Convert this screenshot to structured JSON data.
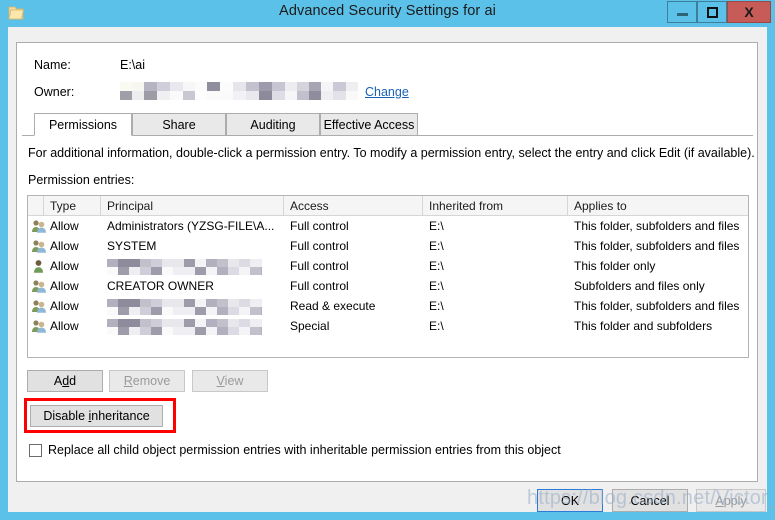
{
  "window": {
    "title": "Advanced Security Settings for ai",
    "icon": "folder-icon",
    "accent_color": "#5CC1E8",
    "close_color": "#C75B58",
    "controls": {
      "minimize": "–",
      "maximize": "□",
      "close": "X"
    }
  },
  "fields": {
    "name_label": "Name:",
    "name_value": "E:\\ai",
    "owner_label": "Owner:",
    "owner_value": "",
    "change_link": "Change"
  },
  "tabs": [
    {
      "label": "Permissions",
      "active": true
    },
    {
      "label": "Share",
      "active": false
    },
    {
      "label": "Auditing",
      "active": false
    },
    {
      "label": "Effective Access",
      "active": false
    }
  ],
  "info_text": "For additional information, double-click a permission entry. To modify a permission entry, select the entry and click Edit (if available).",
  "entries_label": "Permission entries:",
  "table": {
    "columns": [
      "",
      "Type",
      "Principal",
      "Access",
      "Inherited from",
      "Applies to"
    ],
    "rows": [
      {
        "icon": "group-icon",
        "type": "Allow",
        "principal": "Administrators (YZSG-FILE\\A...",
        "redacted": false,
        "access": "Full control",
        "inherited_from": "E:\\",
        "applies_to": "This folder, subfolders and files"
      },
      {
        "icon": "group-icon",
        "type": "Allow",
        "principal": "SYSTEM",
        "redacted": false,
        "access": "Full control",
        "inherited_from": "E:\\",
        "applies_to": "This folder, subfolders and files"
      },
      {
        "icon": "user-icon",
        "type": "Allow",
        "principal": "",
        "redacted": true,
        "access": "Full control",
        "inherited_from": "E:\\",
        "applies_to": "This folder only"
      },
      {
        "icon": "group-icon",
        "type": "Allow",
        "principal": "CREATOR OWNER",
        "redacted": false,
        "access": "Full control",
        "inherited_from": "E:\\",
        "applies_to": "Subfolders and files only"
      },
      {
        "icon": "group-icon",
        "type": "Allow",
        "principal": "",
        "redacted": true,
        "access": "Read & execute",
        "inherited_from": "E:\\",
        "applies_to": "This folder, subfolders and files"
      },
      {
        "icon": "group-icon",
        "type": "Allow",
        "principal": "",
        "redacted": true,
        "access": "Special",
        "inherited_from": "E:\\",
        "applies_to": "This folder and subfolders"
      }
    ]
  },
  "buttons": {
    "add": "Add",
    "remove": "Remove",
    "view": "View",
    "disable_inheritance": "Disable inheritance",
    "ok": "OK",
    "cancel": "Cancel",
    "apply": "Apply"
  },
  "highlight": {
    "color": "#FF0000",
    "target": "disable-inheritance-button"
  },
  "checkbox": {
    "label": "Replace all child object permission entries with inheritable permission entries from this object",
    "checked": false
  },
  "watermark": "https://blog.csdn.net/Victor_code"
}
